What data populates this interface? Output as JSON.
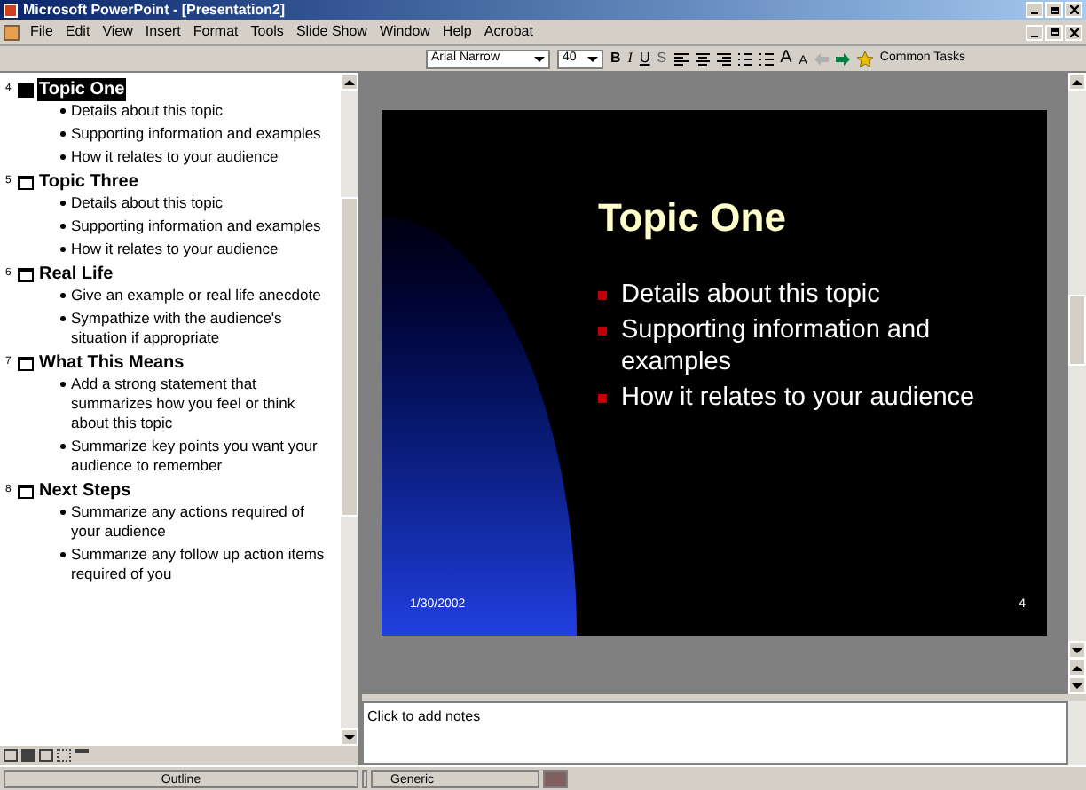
{
  "window": {
    "title": "Microsoft PowerPoint - [Presentation2]"
  },
  "menu": [
    "File",
    "Edit",
    "View",
    "Insert",
    "Format",
    "Tools",
    "Slide Show",
    "Window",
    "Help",
    "Acrobat"
  ],
  "toolbar": {
    "font": "Arial Narrow",
    "size": "40",
    "format_buttons": [
      "B",
      "I",
      "U",
      "S"
    ],
    "font_size_buttons": [
      "A",
      "A"
    ],
    "common_tasks": "Common Tasks"
  },
  "outline": {
    "slides": [
      {
        "number": "4",
        "title": "Topic One",
        "selected": true,
        "bullets": [
          "Details about this topic",
          "Supporting information and examples",
          "How it relates to your audience"
        ]
      },
      {
        "number": "5",
        "title": "Topic Three",
        "selected": false,
        "bullets": [
          "Details about this topic",
          "Supporting information and examples",
          "How it relates to your audience"
        ]
      },
      {
        "number": "6",
        "title": "Real Life",
        "selected": false,
        "bullets": [
          "Give an example or real life anecdote",
          "Sympathize with the audience's situation if appropriate"
        ]
      },
      {
        "number": "7",
        "title": "What This Means",
        "selected": false,
        "bullets": [
          "Add a strong statement that summarizes how you feel or think about this topic",
          "Summarize key points you want your audience to remember"
        ]
      },
      {
        "number": "8",
        "title": "Next Steps",
        "selected": false,
        "bullets": [
          "Summarize any actions required of your audience",
          "Summarize any follow up action items required of you"
        ]
      }
    ]
  },
  "slide": {
    "title": "Topic One",
    "bullets": [
      "Details about this topic",
      "Supporting information and examples",
      "How it relates to your audience"
    ],
    "date": "1/30/2002",
    "page": "4"
  },
  "notes": {
    "placeholder": "Click to add notes"
  },
  "status_bar": [
    "Outline",
    "Generic"
  ]
}
